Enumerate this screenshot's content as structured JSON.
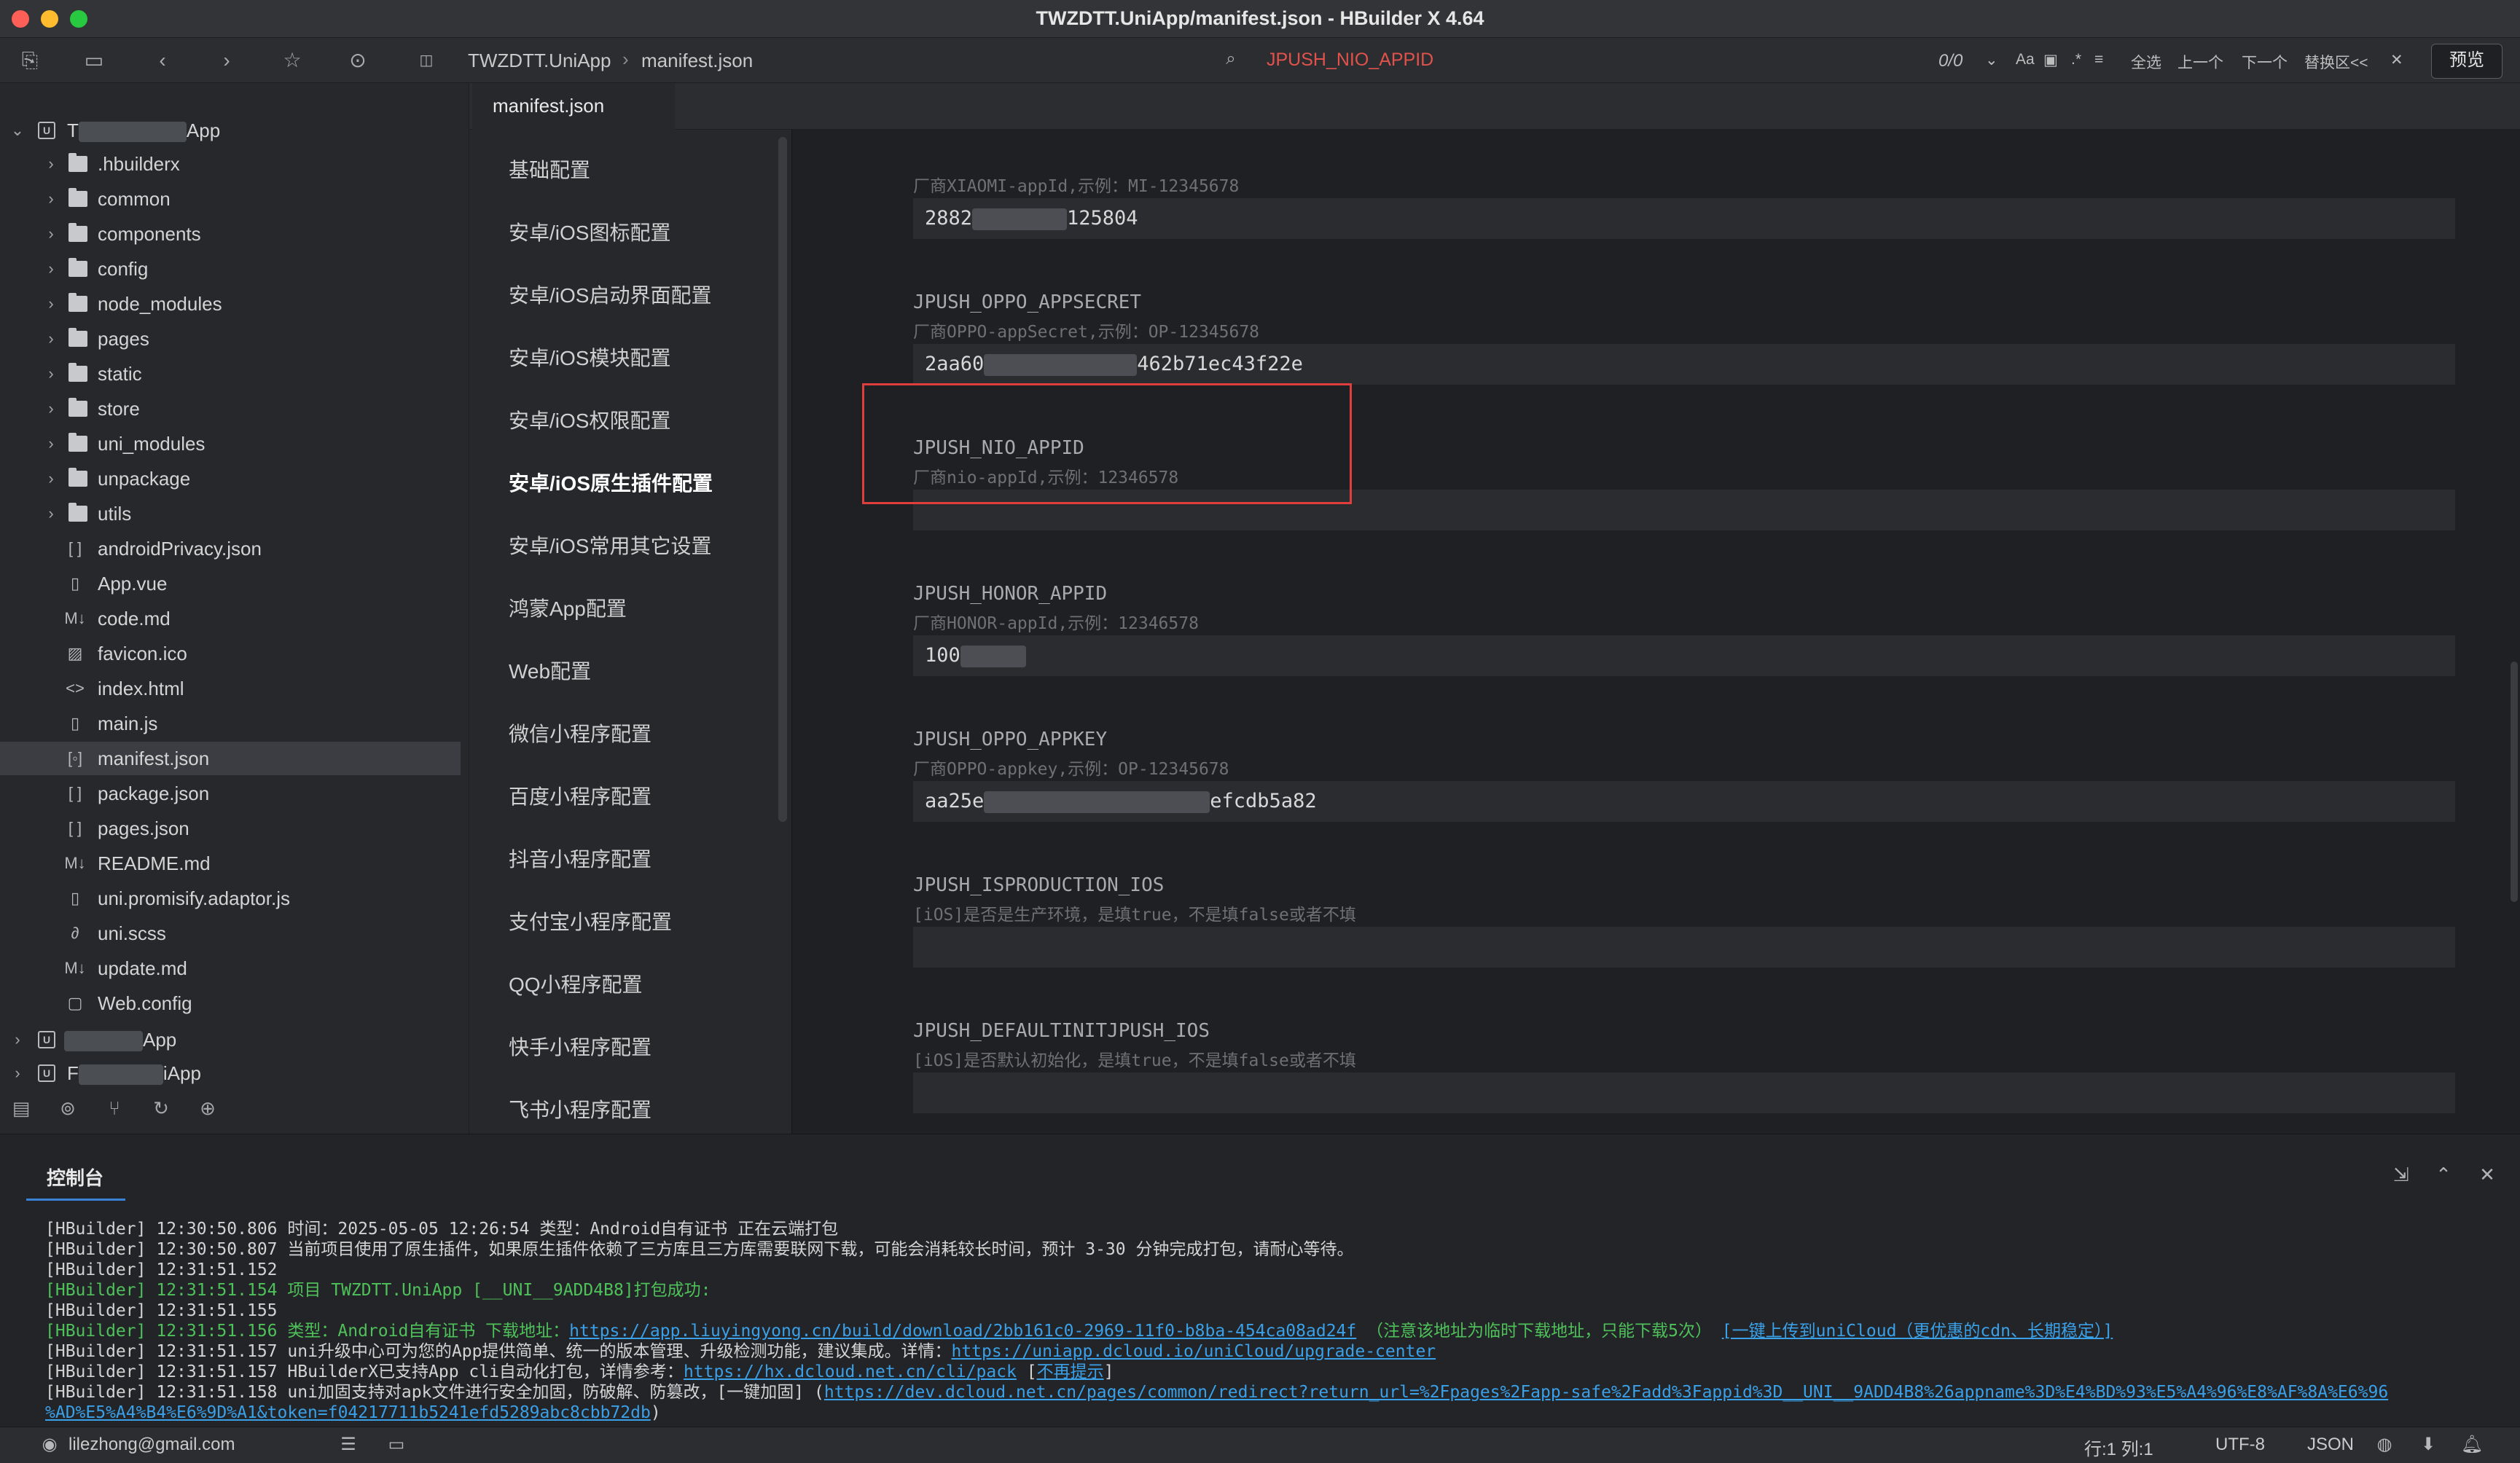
{
  "window": {
    "title": "TWZDTT.UniApp/manifest.json - HBuilder X 4.64"
  },
  "toolbar": {
    "breadcrumb": [
      "TWZDTT.UniApp",
      "manifest.json"
    ],
    "find_text": "JPUSH_NIO_APPID",
    "find_count": "0/0",
    "select_all": "全选",
    "prev": "上一个",
    "next": "下一个",
    "replace": "替换区<<",
    "preview": "预览"
  },
  "sidebar": {
    "project_name_visible": "App",
    "project_name_prefix": "T",
    "tree": [
      {
        "label": ".hbuilderx",
        "type": "folder"
      },
      {
        "label": "common",
        "type": "folder"
      },
      {
        "label": "components",
        "type": "folder"
      },
      {
        "label": "config",
        "type": "folder"
      },
      {
        "label": "node_modules",
        "type": "folder"
      },
      {
        "label": "pages",
        "type": "folder"
      },
      {
        "label": "static",
        "type": "folder"
      },
      {
        "label": "store",
        "type": "folder"
      },
      {
        "label": "uni_modules",
        "type": "folder"
      },
      {
        "label": "unpackage",
        "type": "folder"
      },
      {
        "label": "utils",
        "type": "folder"
      },
      {
        "label": "androidPrivacy.json",
        "type": "json"
      },
      {
        "label": "App.vue",
        "type": "vue"
      },
      {
        "label": "code.md",
        "type": "md"
      },
      {
        "label": "favicon.ico",
        "type": "image"
      },
      {
        "label": "index.html",
        "type": "html"
      },
      {
        "label": "main.js",
        "type": "js"
      },
      {
        "label": "manifest.json",
        "type": "manifest"
      },
      {
        "label": "package.json",
        "type": "json"
      },
      {
        "label": "pages.json",
        "type": "json"
      },
      {
        "label": "README.md",
        "type": "md"
      },
      {
        "label": "uni.promisify.adaptor.js",
        "type": "js"
      },
      {
        "label": "uni.scss",
        "type": "scss"
      },
      {
        "label": "update.md",
        "type": "md"
      },
      {
        "label": "Web.config",
        "type": "file"
      }
    ],
    "other_projects": [
      {
        "suffix": "App"
      },
      {
        "prefix": "F",
        "suffix": "iApp"
      }
    ]
  },
  "editor": {
    "tab": "manifest.json"
  },
  "settings_nav": [
    "基础配置",
    "安卓/iOS图标配置",
    "安卓/iOS启动界面配置",
    "安卓/iOS模块配置",
    "安卓/iOS权限配置",
    "安卓/iOS原生插件配置",
    "安卓/iOS常用其它设置",
    "鸿蒙App配置",
    "Web配置",
    "微信小程序配置",
    "百度小程序配置",
    "抖音小程序配置",
    "支付宝小程序配置",
    "QQ小程序配置",
    "快手小程序配置",
    "飞书小程序配置"
  ],
  "settings_active": "安卓/iOS原生插件配置",
  "fields": [
    {
      "key": "",
      "hint": "厂商XIAOMI-appId,示例：MI-12345678",
      "value_start": "2882",
      "value_end": "125804"
    },
    {
      "key": "JPUSH_OPPO_APPSECRET",
      "hint": "厂商OPPO-appSecret,示例：OP-12345678",
      "value_start": "2aa60",
      "value_end": "462b71ec43f22e"
    },
    {
      "key": "JPUSH_NIO_APPID",
      "hint": "厂商nio-appId,示例：12346578",
      "value_start": "",
      "value_end": ""
    },
    {
      "key": "JPUSH_HONOR_APPID",
      "hint": "厂商HONOR-appId,示例：12346578",
      "value_start": "100",
      "value_end": ""
    },
    {
      "key": "JPUSH_OPPO_APPKEY",
      "hint": "厂商OPPO-appkey,示例：OP-12345678",
      "value_start": "aa25e",
      "value_end": "efcdb5a82"
    },
    {
      "key": "JPUSH_ISPRODUCTION_IOS",
      "hint": "[iOS]是否是生产环境，是填true，不是填false或者不填",
      "value_start": "",
      "value_end": ""
    },
    {
      "key": "JPUSH_DEFAULTINITJPUSH_IOS",
      "hint": "[iOS]是否默认初始化，是填true，不是填false或者不填",
      "value_start": "",
      "value_end": ""
    }
  ],
  "console": {
    "tab": "控制台",
    "lines": [
      {
        "tag": "[HBuilder]",
        "time": "12:30:50.806",
        "text": "时间：2025-05-05 12:26:54    类型：Android自有证书    正在云端打包",
        "color": "normal"
      },
      {
        "tag": "[HBuilder]",
        "time": "12:30:50.807",
        "text": "当前项目使用了原生插件，如果原生插件依赖了三方库且三方库需要联网下载，可能会消耗较长时间，预计 3-30 分钟完成打包，请耐心等待。",
        "color": "normal"
      },
      {
        "tag": "[HBuilder]",
        "time": "12:31:51.152",
        "text": "",
        "color": "normal"
      },
      {
        "tag": "[HBuilder]",
        "time": "12:31:51.154",
        "text": "项目 TWZDTT.UniApp [__UNI__9ADD4B8]打包成功:",
        "color": "green"
      },
      {
        "tag": "[HBuilder]",
        "time": "12:31:51.155",
        "text": "",
        "color": "normal"
      },
      {
        "tag": "[HBuilder]",
        "time": "12:31:51.156",
        "text": "类型：Android自有证书 下载地址：",
        "link": "https://app.liuyingyong.cn/build/download/2bb161c0-2969-11f0-b8ba-454ca08ad24f",
        "after": " （注意该地址为临时下载地址，只能下载5次）     ",
        "link2": "[一键上传到uniCloud（更优惠的cdn、长期稳定）]",
        "color": "green"
      },
      {
        "tag": "[HBuilder]",
        "time": "12:31:51.157",
        "text": "uni升级中心可为您的App提供简单、统一的版本管理、升级检测功能，建议集成。详情：",
        "link": "https://uniapp.dcloud.io/uniCloud/upgrade-center",
        "color": "normal"
      },
      {
        "tag": "[HBuilder]",
        "time": "12:31:51.157",
        "text": "HBuilderX已支持App cli自动化打包，详情参考：",
        "link": "https://hx.dcloud.net.cn/cli/pack",
        "after": " [",
        "link2": "不再提示",
        "after2": "]",
        "color": "normal"
      },
      {
        "tag": "[HBuilder]",
        "time": "12:31:51.158",
        "text": "uni加固支持对apk文件进行安全加固，防破解、防篡改，[一键加固] (",
        "link": "https://dev.dcloud.net.cn/pages/common/redirect?return_url=%2Fpages%2Fapp-safe%2Fadd%3Fappid%3D__UNI__9ADD4B8%26appname%3D%E4%BD%93%E5%A4%96%E8%AF%8A%E6%96",
        "color": "normal"
      },
      {
        "tag": "",
        "time": "",
        "text": "",
        "link": "%AD%E5%A4%B4%E6%9D%A1&token=f04217711b5241efd5289abc8cbb72db",
        "after": ")",
        "color": "normal"
      }
    ]
  },
  "statusbar": {
    "user": "lilezhong@gmail.com",
    "position": "行:1  列:1",
    "encoding": "UTF-8",
    "language": "JSON"
  }
}
